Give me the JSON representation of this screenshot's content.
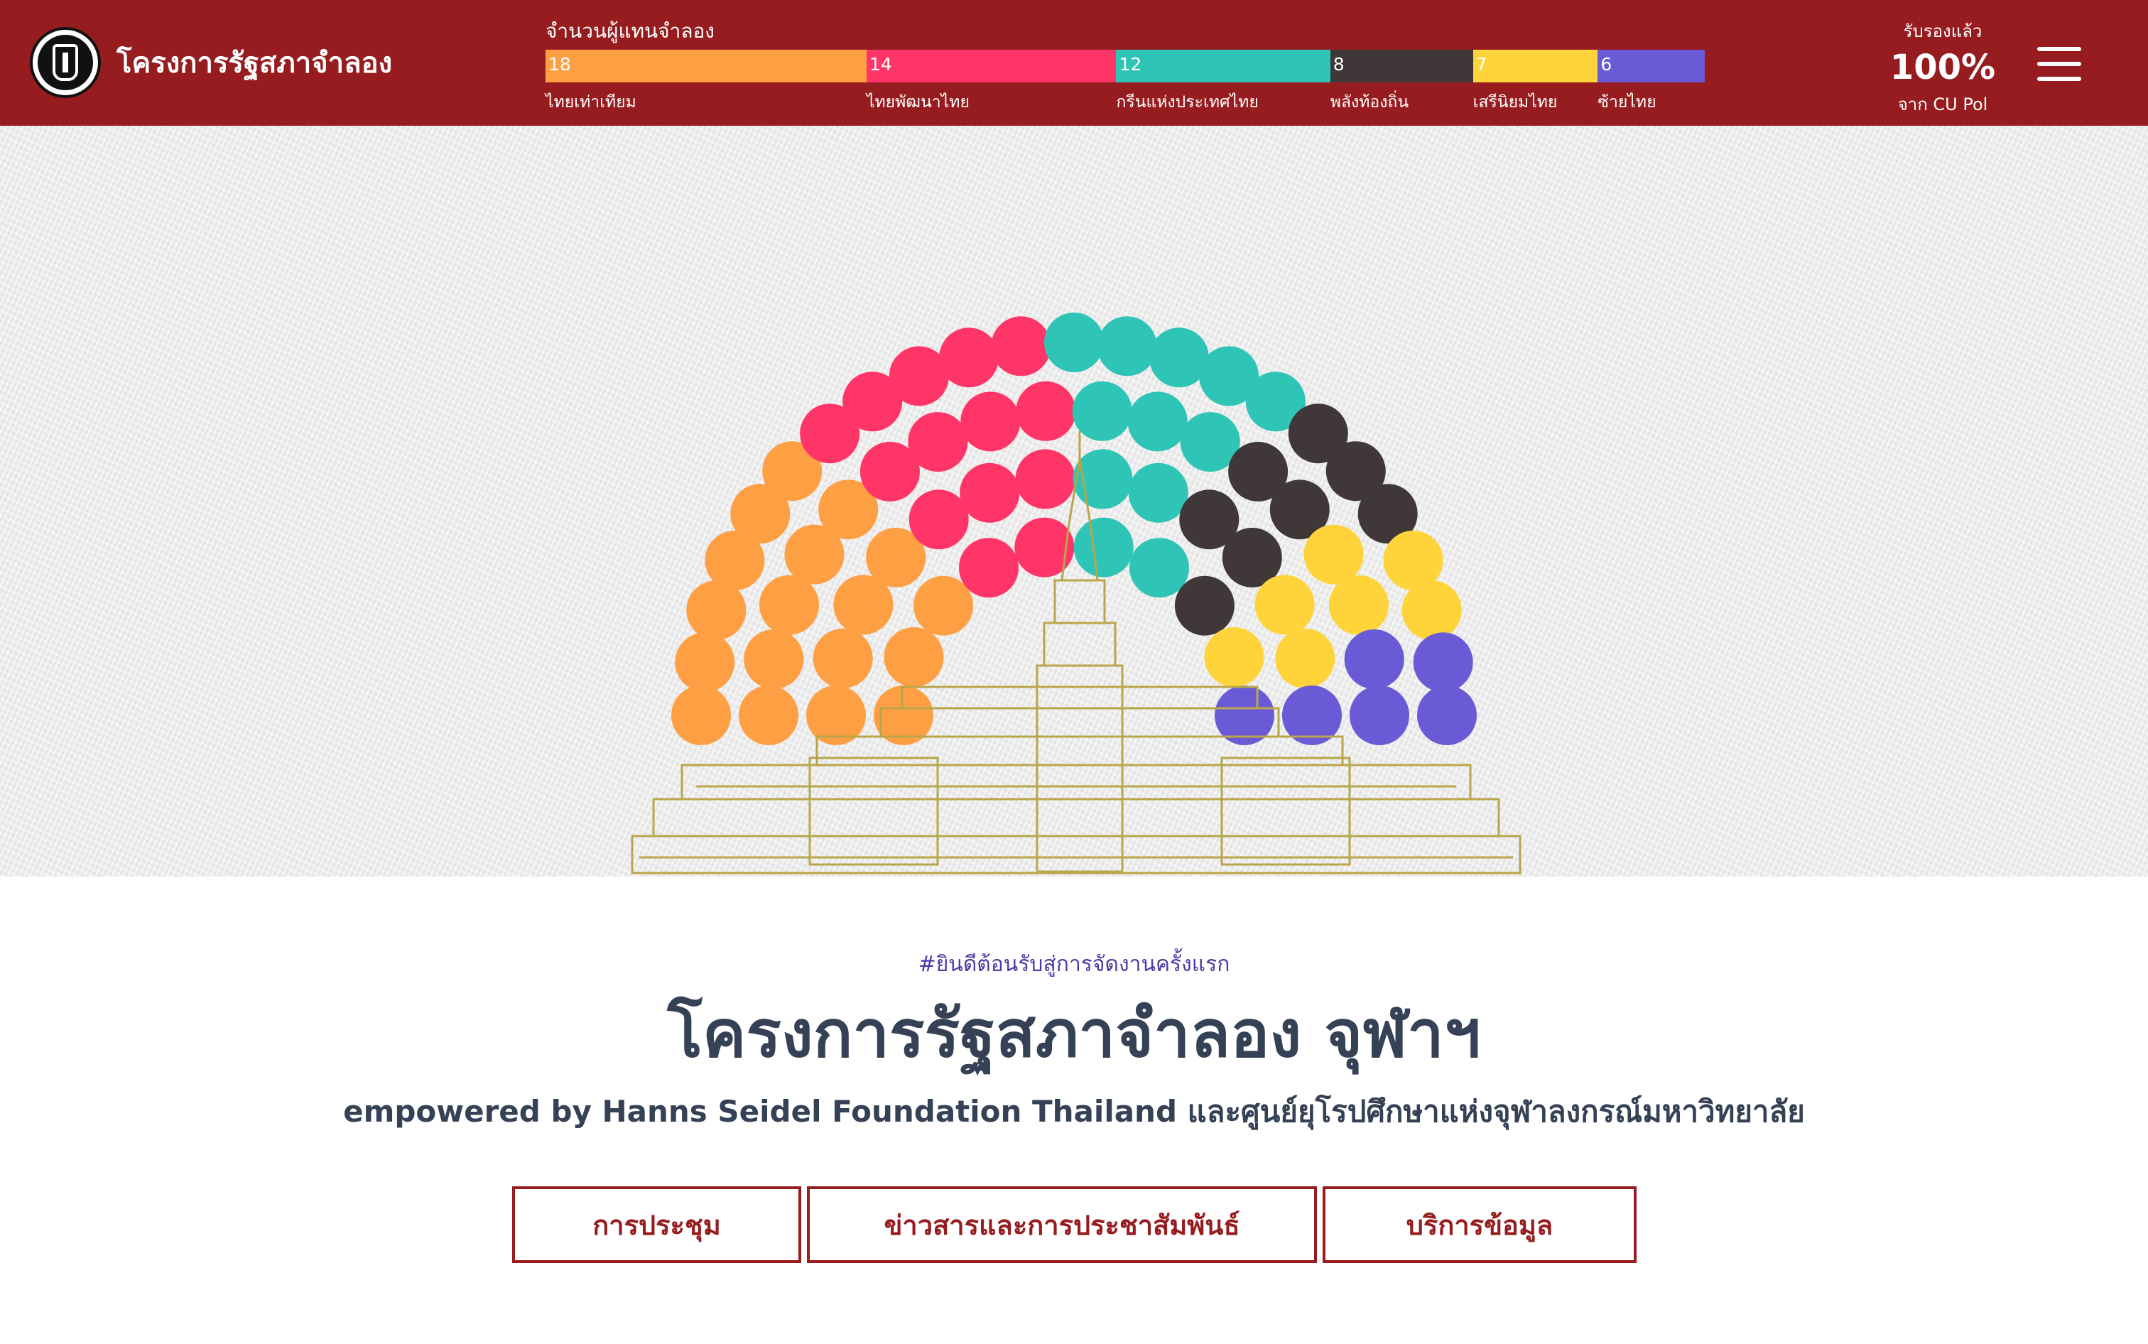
{
  "header": {
    "site_title": "โครงการรัฐสภาจำลอง",
    "seat_label": "จำนวนผู้แทนจำลอง",
    "certified_label": "รับรองแล้ว",
    "certified_value": "100%",
    "certified_source": "จาก CU Pol"
  },
  "parties": [
    {
      "name": "ไทยเท่าเทียม",
      "seats": 18,
      "color": "#ff9f43"
    },
    {
      "name": "ไทยพัฒนาไทย",
      "seats": 14,
      "color": "#ff3567"
    },
    {
      "name": "กรีนแห่งประเทศไทย",
      "seats": 12,
      "color": "#2ec4b6"
    },
    {
      "name": "พลังท้องถิ่น",
      "seats": 8,
      "color": "#403838"
    },
    {
      "name": "เสรีนิยมไทย",
      "seats": 7,
      "color": "#ffd43b"
    },
    {
      "name": "ซ้ายไทย",
      "seats": 6,
      "color": "#6a5ad6"
    }
  ],
  "hero": {
    "building_icon": "parliament-building-icon"
  },
  "content": {
    "tagline": "#ยินดีต้อนรับสู่การจัดงานครั้งแรก",
    "title": "โครงการรัฐสภาจำลอง จุฬาฯ",
    "subtitle": "empowered by Hanns Seidel Foundation Thailand และศูนย์ยุโรปศึกษาแห่งจุฬาลงกรณ์มหาวิทยาลัย"
  },
  "buttons": {
    "meeting": "การประชุม",
    "news": "ข่าวสารและการประชาสัมพันธ์",
    "services": "บริการข้อมูล"
  }
}
